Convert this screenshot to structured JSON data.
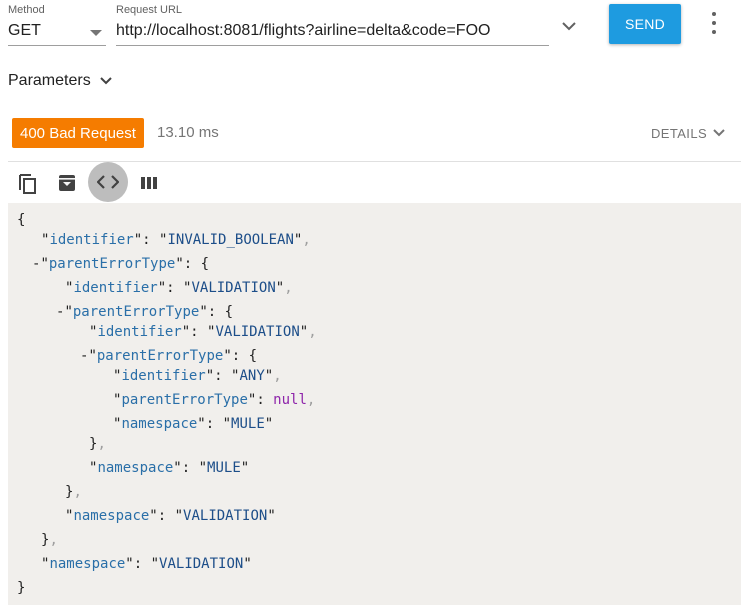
{
  "request": {
    "method_label": "Method",
    "method_value": "GET",
    "url_label": "Request URL",
    "url_value": "http://localhost:8081/flights?airline=delta&code=FOO",
    "send_label": "SEND"
  },
  "parameters_label": "Parameters",
  "response": {
    "status": "400 Bad Request",
    "time": "13.10 ms",
    "details_label": "DETAILS",
    "status_color": "#f57c00"
  },
  "toolbar": {
    "icons": [
      "copy-icon",
      "save-icon",
      "code-view-icon",
      "columns-icon"
    ]
  },
  "json_body": {
    "open": "{",
    "close": "}",
    "identifier_key": "identifier",
    "parent_key": "parentErrorType",
    "namespace_key": "namespace",
    "l1_identifier": "INVALID_BOOLEAN",
    "l2_identifier": "VALIDATION",
    "l3_identifier": "VALIDATION",
    "l4_identifier": "ANY",
    "l4_parent": "null",
    "l4_namespace": "MULE",
    "l3_namespace": "MULE",
    "l2_namespace": "VALIDATION",
    "l1_namespace": "VALIDATION"
  },
  "colors": {
    "accent": "#1e9be0",
    "error": "#f57c00"
  }
}
